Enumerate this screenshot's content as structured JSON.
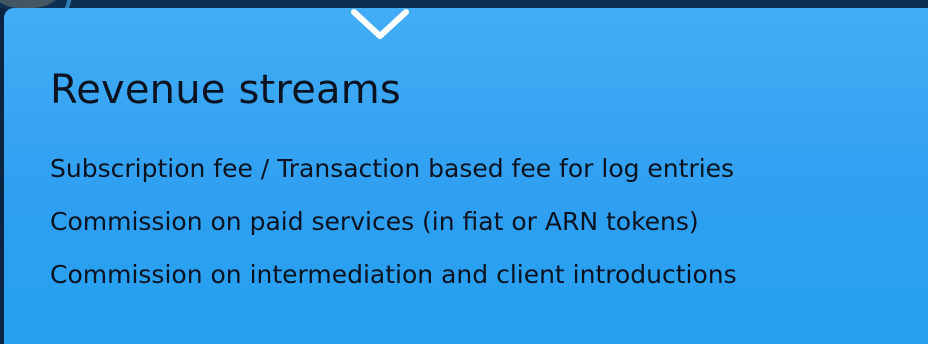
{
  "colors": {
    "panel_top": "#43adf6",
    "panel_bottom": "#24a0f0",
    "text": "#0b1220",
    "background": "#0d2b47",
    "chevron": "#ffffff"
  },
  "toggle": {
    "icon": "chevron-down-icon"
  },
  "panel": {
    "title": "Revenue streams",
    "items": [
      {
        "label": "Subscription fee / Transaction based fee for log entries"
      },
      {
        "label": "Commission on paid services (in fiat or ARN tokens)"
      },
      {
        "label": "Commission on intermediation and client introductions"
      }
    ]
  }
}
